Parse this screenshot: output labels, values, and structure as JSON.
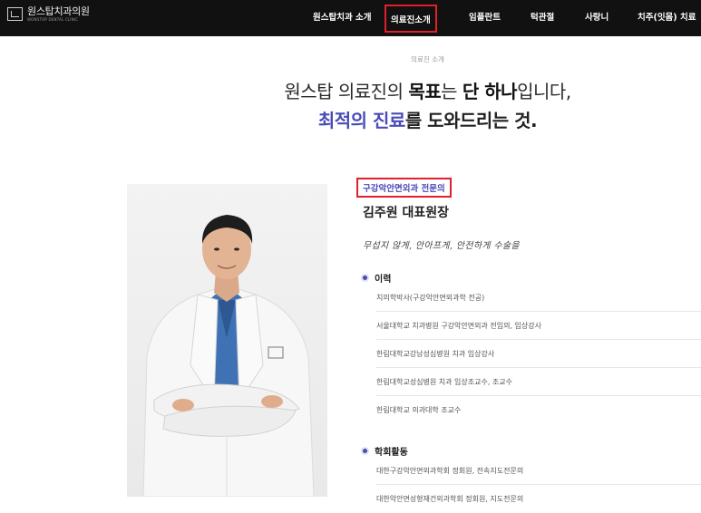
{
  "header": {
    "logo_name": "원스탑치과의원",
    "logo_sub": "WONSTOP DENTAL CLINIC",
    "nav": [
      {
        "label": "원스탑치과 소개"
      },
      {
        "label": "의료진소개"
      },
      {
        "label": "임플란트"
      },
      {
        "label": "턱관절"
      },
      {
        "label": "사랑니"
      },
      {
        "label": "치주(잇몸) 치료"
      }
    ]
  },
  "hero": {
    "eyebrow": "의료진 소개",
    "line1_pre": "원스탑 의료진의 ",
    "line1_bold1": "목표",
    "line1_mid": "는 ",
    "line1_bold2": "단 하나",
    "line1_post": "입니다,",
    "line2_accent": "최적의 진료",
    "line2_post": "를 도와드리는 것."
  },
  "profile": {
    "specialty": "구강악안면외과 전문의",
    "name": "김주원 대표원장",
    "motto": "무섭지 않게, 안아프게, 안전하게 수술을",
    "career_title": "이력",
    "career": [
      "치의학박사(구강악안면외과학 전공)",
      "서울대학교 치과병원 구강악안면외과 전임의, 임상강사",
      "한림대학교강남성심병원 치과 임상강사",
      "한림대학교성심병원 치과 임상조교수, 조교수",
      "한림대학교 의과대학 조교수"
    ],
    "society_title": "학회활동",
    "society": [
      "대한구강악안면외과학회 정회원, 전속지도전문의",
      "대한악안면성형재건외과학회 정회원, 지도전문의"
    ]
  },
  "colors": {
    "accent": "#4b4bb8",
    "highlight_box": "#e0202a",
    "header_bg": "#111111"
  }
}
